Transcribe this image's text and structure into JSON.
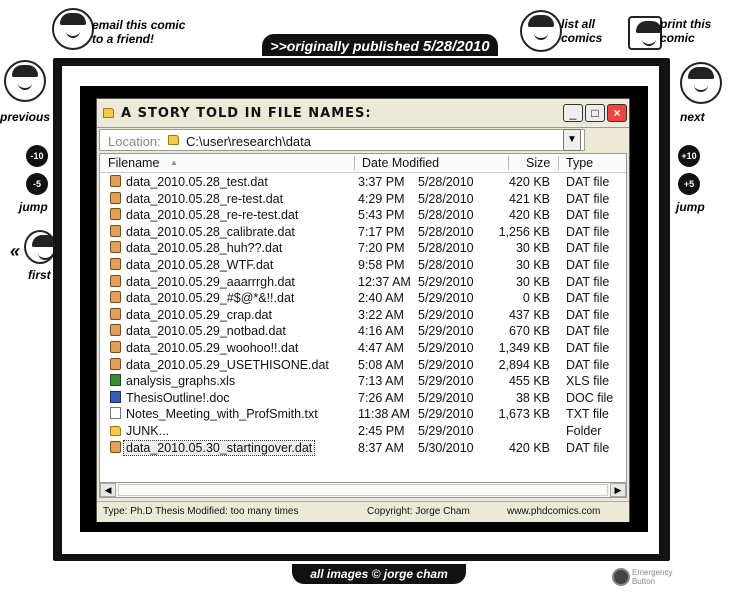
{
  "nav": {
    "email_line1": "email this comic",
    "email_line2": "to a friend!",
    "list_line1": "list all",
    "list_line2": "comics",
    "print_line1": "print this",
    "print_line2": "comic",
    "previous": "previous",
    "next": "next",
    "jump_left": "jump",
    "jump_right": "jump",
    "first": "first",
    "jump_minus10": "-10",
    "jump_minus5": "-5",
    "jump_plus10": "+10",
    "jump_plus5": "+5",
    "first_arrow": "«"
  },
  "published": {
    "prefix": ">>originally published",
    "date": "5/28/2010"
  },
  "footer": {
    "copyright": "all images © jorge cham",
    "emergency_line1": "Emergency",
    "emergency_line2": "Button"
  },
  "window": {
    "title": "A STORY TOLD IN FILE NAMES:",
    "location_label": "Location:",
    "location_path": "C:\\user\\research\\data",
    "minimize": "_",
    "maximize": "□",
    "close": "×",
    "columns": {
      "filename": "Filename",
      "date_modified": "Date Modified",
      "size": "Size",
      "type": "Type"
    },
    "files": [
      {
        "name": "data_2010.05.28_test.dat",
        "time": "3:37 PM",
        "date": "5/28/2010",
        "size": "420 KB",
        "type": "DAT file",
        "icon": "dat-file-icon"
      },
      {
        "name": "data_2010.05.28_re-test.dat",
        "time": "4:29 PM",
        "date": "5/28/2010",
        "size": "421 KB",
        "type": "DAT file",
        "icon": "dat-file-icon"
      },
      {
        "name": "data_2010.05.28_re-re-test.dat",
        "time": "5:43 PM",
        "date": "5/28/2010",
        "size": "420 KB",
        "type": "DAT file",
        "icon": "dat-file-icon"
      },
      {
        "name": "data_2010.05.28_calibrate.dat",
        "time": "7:17 PM",
        "date": "5/28/2010",
        "size": "1,256 KB",
        "type": "DAT file",
        "icon": "dat-file-icon"
      },
      {
        "name": "data_2010.05.28_huh??.dat",
        "time": "7:20 PM",
        "date": "5/28/2010",
        "size": "30 KB",
        "type": "DAT file",
        "icon": "dat-file-icon"
      },
      {
        "name": "data_2010.05.28_WTF.dat",
        "time": "9:58 PM",
        "date": "5/28/2010",
        "size": "30 KB",
        "type": "DAT file",
        "icon": "dat-file-icon"
      },
      {
        "name": "data_2010.05.29_aaarrrgh.dat",
        "time": "12:37 AM",
        "date": "5/29/2010",
        "size": "30 KB",
        "type": "DAT file",
        "icon": "dat-file-icon"
      },
      {
        "name": "data_2010.05.29_#$@*&!!.dat",
        "time": "2:40 AM",
        "date": "5/29/2010",
        "size": "0 KB",
        "type": "DAT file",
        "icon": "dat-file-icon"
      },
      {
        "name": "data_2010.05.29_crap.dat",
        "time": "3:22 AM",
        "date": "5/29/2010",
        "size": "437 KB",
        "type": "DAT file",
        "icon": "dat-file-icon"
      },
      {
        "name": "data_2010.05.29_notbad.dat",
        "time": "4:16 AM",
        "date": "5/29/2010",
        "size": "670 KB",
        "type": "DAT file",
        "icon": "dat-file-icon"
      },
      {
        "name": "data_2010.05.29_woohoo!!.dat",
        "time": "4:47 AM",
        "date": "5/29/2010",
        "size": "1,349 KB",
        "type": "DAT file",
        "icon": "dat-file-icon"
      },
      {
        "name": "data_2010.05.29_USETHISONE.dat",
        "time": "5:08 AM",
        "date": "5/29/2010",
        "size": "2,894 KB",
        "type": "DAT file",
        "icon": "dat-file-icon"
      },
      {
        "name": "analysis_graphs.xls",
        "time": "7:13 AM",
        "date": "5/29/2010",
        "size": "455 KB",
        "type": "XLS file",
        "icon": "xls-file-icon"
      },
      {
        "name": "ThesisOutline!.doc",
        "time": "7:26 AM",
        "date": "5/29/2010",
        "size": "38 KB",
        "type": "DOC file",
        "icon": "doc-file-icon"
      },
      {
        "name": "Notes_Meeting_with_ProfSmith.txt",
        "time": "11:38 AM",
        "date": "5/29/2010",
        "size": "1,673 KB",
        "type": "TXT file",
        "icon": "txt-file-icon"
      },
      {
        "name": "JUNK...",
        "time": "2:45 PM",
        "date": "5/29/2010",
        "size": "",
        "type": "Folder",
        "icon": "folder-icon"
      },
      {
        "name": "data_2010.05.30_startingover.dat",
        "time": "8:37 AM",
        "date": "5/30/2010",
        "size": "420 KB",
        "type": "DAT file",
        "icon": "dat-file-icon"
      }
    ],
    "status": {
      "left": "Type: Ph.D Thesis  Modified: too many times",
      "middle": "Copyright: Jorge Cham",
      "right": "www.phdcomics.com"
    }
  }
}
